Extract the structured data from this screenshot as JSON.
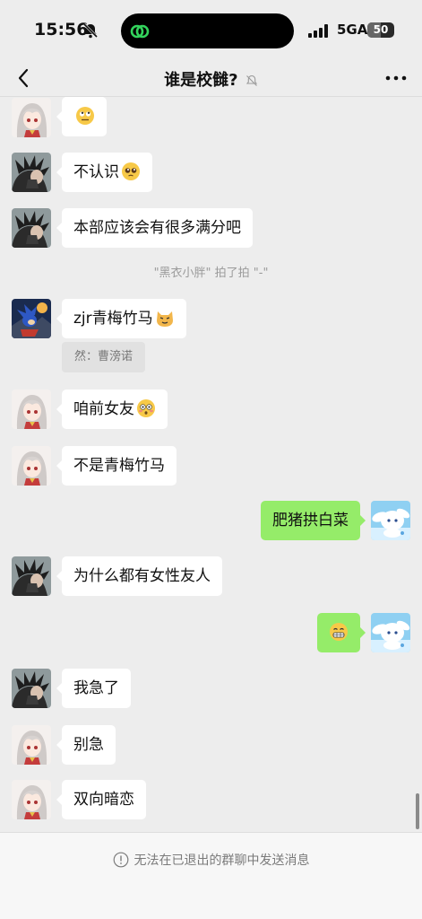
{
  "status_bar": {
    "time": "15:56",
    "network": "5GA",
    "battery": "50",
    "battery_level": 0.5
  },
  "header": {
    "title": "谁是校雠?"
  },
  "messages": [
    {
      "side": "left",
      "avatar": "anime-girl",
      "text": "",
      "emoji": "rolling-eyes-emoji"
    },
    {
      "side": "left",
      "avatar": "dark-hair-boy",
      "text": "不认识",
      "emoji": "pleading-face-emoji"
    },
    {
      "side": "left",
      "avatar": "dark-hair-boy",
      "text": "本部应该会有很多满分吧",
      "emoji": ""
    },
    {
      "side": "left",
      "avatar": "dark-hair-boy",
      "text": "",
      "emoji": ""
    },
    {
      "side": "left",
      "avatar": "sonic",
      "text": "zjr青梅竹马",
      "emoji": "cat-face-emoji"
    },
    {
      "side": "left",
      "avatar": "anime-girl",
      "text": "咱前女友",
      "emoji": "flushed-face-emoji"
    },
    {
      "side": "left",
      "avatar": "anime-girl",
      "text": "不是青梅竹马",
      "emoji": ""
    },
    {
      "side": "right",
      "avatar": "cinnamoroll",
      "text": "肥猪拱白菜",
      "emoji": ""
    },
    {
      "side": "left",
      "avatar": "dark-hair-boy",
      "text": "为什么都有女性友人",
      "emoji": ""
    },
    {
      "side": "right",
      "avatar": "cinnamoroll",
      "text": "",
      "emoji": "grimacing-face-emoji"
    },
    {
      "side": "left",
      "avatar": "dark-hair-boy",
      "text": "我急了",
      "emoji": ""
    },
    {
      "side": "left",
      "avatar": "anime-girl",
      "text": "别急",
      "emoji": ""
    },
    {
      "side": "left",
      "avatar": "anime-girl",
      "text": "双向暗恋",
      "emoji": ""
    }
  ],
  "system_note": "\"黑衣小胖\" 拍了拍 \"-\"",
  "quote": "然：曹滂诺",
  "footer": {
    "notice": "无法在已退出的群聊中发送消息"
  }
}
